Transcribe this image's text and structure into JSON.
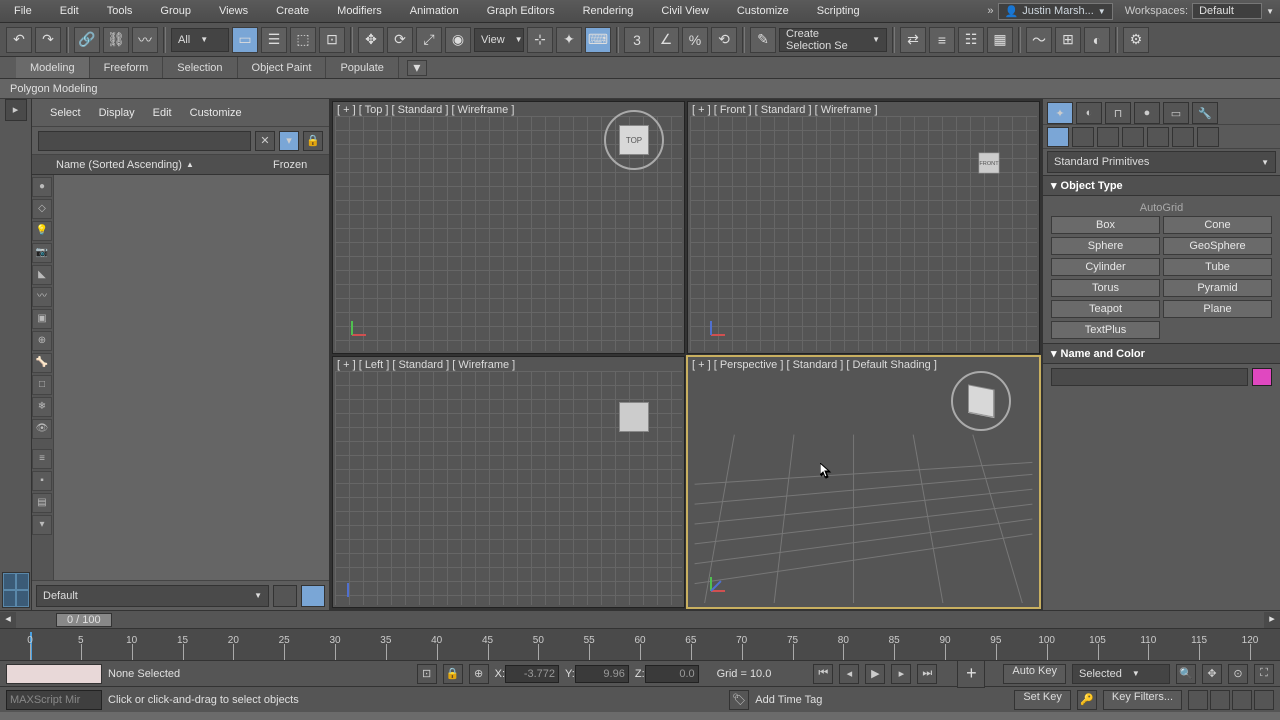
{
  "menu": {
    "items": [
      "File",
      "Edit",
      "Tools",
      "Group",
      "Views",
      "Create",
      "Modifiers",
      "Animation",
      "Graph Editors",
      "Rendering",
      "Civil View",
      "Customize",
      "Scripting"
    ],
    "user": "Justin Marsh...",
    "wslabel": "Workspaces:",
    "wsval": "Default"
  },
  "toolbar": {
    "filter": "All",
    "viewmode": "View",
    "selset": "Create Selection Se"
  },
  "ribbon": {
    "tabs": [
      "Modeling",
      "Freeform",
      "Selection",
      "Object Paint",
      "Populate"
    ],
    "sub": "Polygon Modeling"
  },
  "scene": {
    "menus": [
      "Select",
      "Display",
      "Edit",
      "Customize"
    ],
    "col1": "Name (Sorted Ascending)",
    "col2": "Frozen",
    "layer": "Default"
  },
  "viewports": {
    "top": "[ + ] [ Top ] [ Standard ] [ Wireframe ]",
    "front": "[ + ] [ Front ] [ Standard ] [ Wireframe ]",
    "left": "[ + ] [ Left ] [ Standard ] [ Wireframe ]",
    "persp": "[ + ] [ Perspective ] [ Standard ] [ Default Shading ]",
    "cube_top": "TOP",
    "cube_front": "FRONT"
  },
  "cmd": {
    "dropdown": "Standard Primitives",
    "obj_head": "Object Type",
    "autogrid": "AutoGrid",
    "buttons": [
      "Box",
      "Cone",
      "Sphere",
      "GeoSphere",
      "Cylinder",
      "Tube",
      "Torus",
      "Pyramid",
      "Teapot",
      "Plane",
      "TextPlus"
    ],
    "name_head": "Name and Color"
  },
  "timeline": {
    "frame": "0 / 100",
    "xlabel": "X:",
    "ylabel": "Y:",
    "zlabel": "Z:",
    "x": "-3.772",
    "y": "9.96",
    "z": "0.0",
    "gridlabel": "Grid = 10.0",
    "none": "None Selected",
    "prompt": "Click or click-and-drag to select objects",
    "mx": "MAXScript Mir",
    "addtag": "Add Time Tag",
    "autokey": "Auto Key",
    "setkey": "Set Key",
    "selected": "Selected",
    "keyfilters": "Key Filters..."
  }
}
